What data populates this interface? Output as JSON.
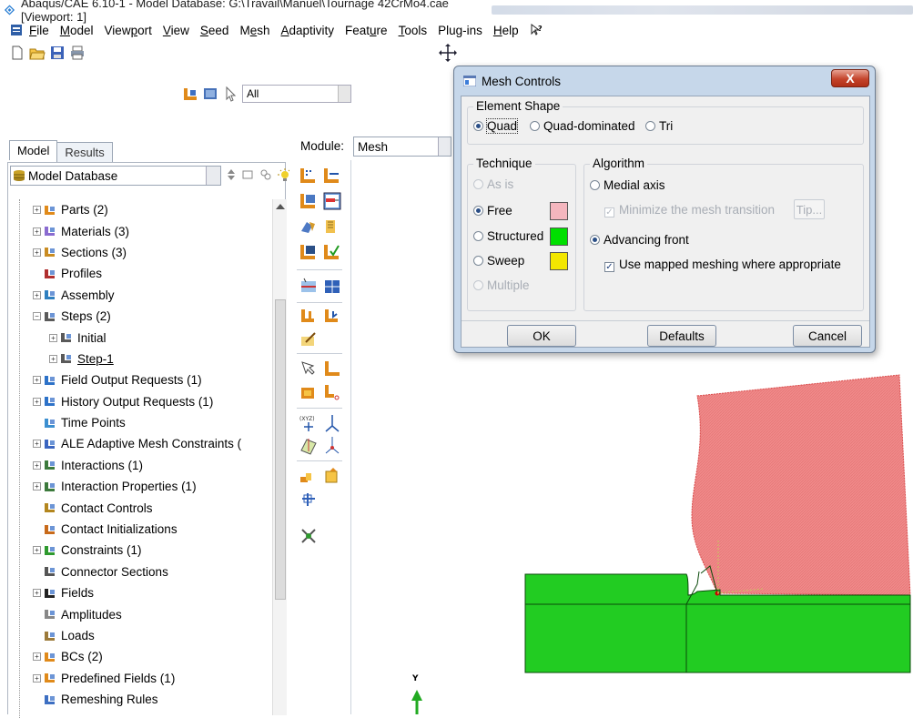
{
  "window": {
    "title": "Abaqus/CAE 6.10-1 - Model Database: G:\\Travail\\Manuel\\Tournage 42CrMo4.cae [Viewport: 1]"
  },
  "menubar": {
    "items": [
      "File",
      "Model",
      "Viewport",
      "View",
      "Seed",
      "Mesh",
      "Adaptivity",
      "Feature",
      "Tools",
      "Plug-ins",
      "Help"
    ],
    "underlines": [
      "F",
      "M",
      "p",
      "V",
      "S",
      "e",
      "A",
      "u",
      "T",
      "g",
      "H"
    ]
  },
  "toolbar": {
    "selection_filter": "All"
  },
  "left_panel": {
    "tabs": [
      "Model",
      "Results"
    ],
    "active_tab": "Model",
    "database_combo": "Model Database",
    "tree": [
      {
        "label": "Parts (2)",
        "level": 1,
        "expander": "+"
      },
      {
        "label": "Materials (3)",
        "level": 1,
        "expander": "+"
      },
      {
        "label": "Sections (3)",
        "level": 1,
        "expander": "+"
      },
      {
        "label": "Profiles",
        "level": 1,
        "expander": ""
      },
      {
        "label": "Assembly",
        "level": 1,
        "expander": "+"
      },
      {
        "label": "Steps (2)",
        "level": 1,
        "expander": "−"
      },
      {
        "label": "Initial",
        "level": 2,
        "expander": "+"
      },
      {
        "label": "Step-1",
        "level": 2,
        "expander": "+",
        "underline": true
      },
      {
        "label": "Field Output Requests (1)",
        "level": 1,
        "expander": "+"
      },
      {
        "label": "History Output Requests (1)",
        "level": 1,
        "expander": "+"
      },
      {
        "label": "Time Points",
        "level": 1,
        "expander": ""
      },
      {
        "label": "ALE Adaptive Mesh Constraints (",
        "level": 1,
        "expander": "+"
      },
      {
        "label": "Interactions (1)",
        "level": 1,
        "expander": "+"
      },
      {
        "label": "Interaction Properties (1)",
        "level": 1,
        "expander": "+"
      },
      {
        "label": "Contact Controls",
        "level": 1,
        "expander": ""
      },
      {
        "label": "Contact Initializations",
        "level": 1,
        "expander": ""
      },
      {
        "label": "Constraints (1)",
        "level": 1,
        "expander": "+"
      },
      {
        "label": "Connector Sections",
        "level": 1,
        "expander": ""
      },
      {
        "label": "Fields",
        "level": 1,
        "expander": "+"
      },
      {
        "label": "Amplitudes",
        "level": 1,
        "expander": ""
      },
      {
        "label": "Loads",
        "level": 1,
        "expander": ""
      },
      {
        "label": "BCs (2)",
        "level": 1,
        "expander": "+"
      },
      {
        "label": "Predefined Fields (1)",
        "level": 1,
        "expander": "+"
      },
      {
        "label": "Remeshing Rules",
        "level": 1,
        "expander": ""
      }
    ]
  },
  "module": {
    "label": "Module:",
    "value": "Mesh"
  },
  "viewport": {
    "axis_label": "Y",
    "tool_color": "#f08a8a",
    "workpiece_color": "#22cc22"
  },
  "dialog": {
    "title": "Mesh Controls",
    "close_label": "X",
    "element_shape": {
      "title": "Element Shape",
      "options": [
        "Quad",
        "Quad-dominated",
        "Tri"
      ],
      "selected": "Quad"
    },
    "technique": {
      "title": "Technique",
      "options": [
        "As is",
        "Free",
        "Structured",
        "Sweep",
        "Multiple"
      ],
      "selected": "Free",
      "colors": {
        "Free": "#f4b6be",
        "Structured": "#00e000",
        "Sweep": "#f3e600"
      }
    },
    "algorithm": {
      "title": "Algorithm",
      "medial_axis": "Medial axis",
      "minimize_transition": "Minimize the mesh transition",
      "tip": "Tip...",
      "advancing_front": "Advancing front",
      "mapped_meshing": "Use mapped meshing where appropriate",
      "selected": "Advancing front"
    },
    "buttons": {
      "ok": "OK",
      "defaults": "Defaults",
      "cancel": "Cancel"
    }
  }
}
